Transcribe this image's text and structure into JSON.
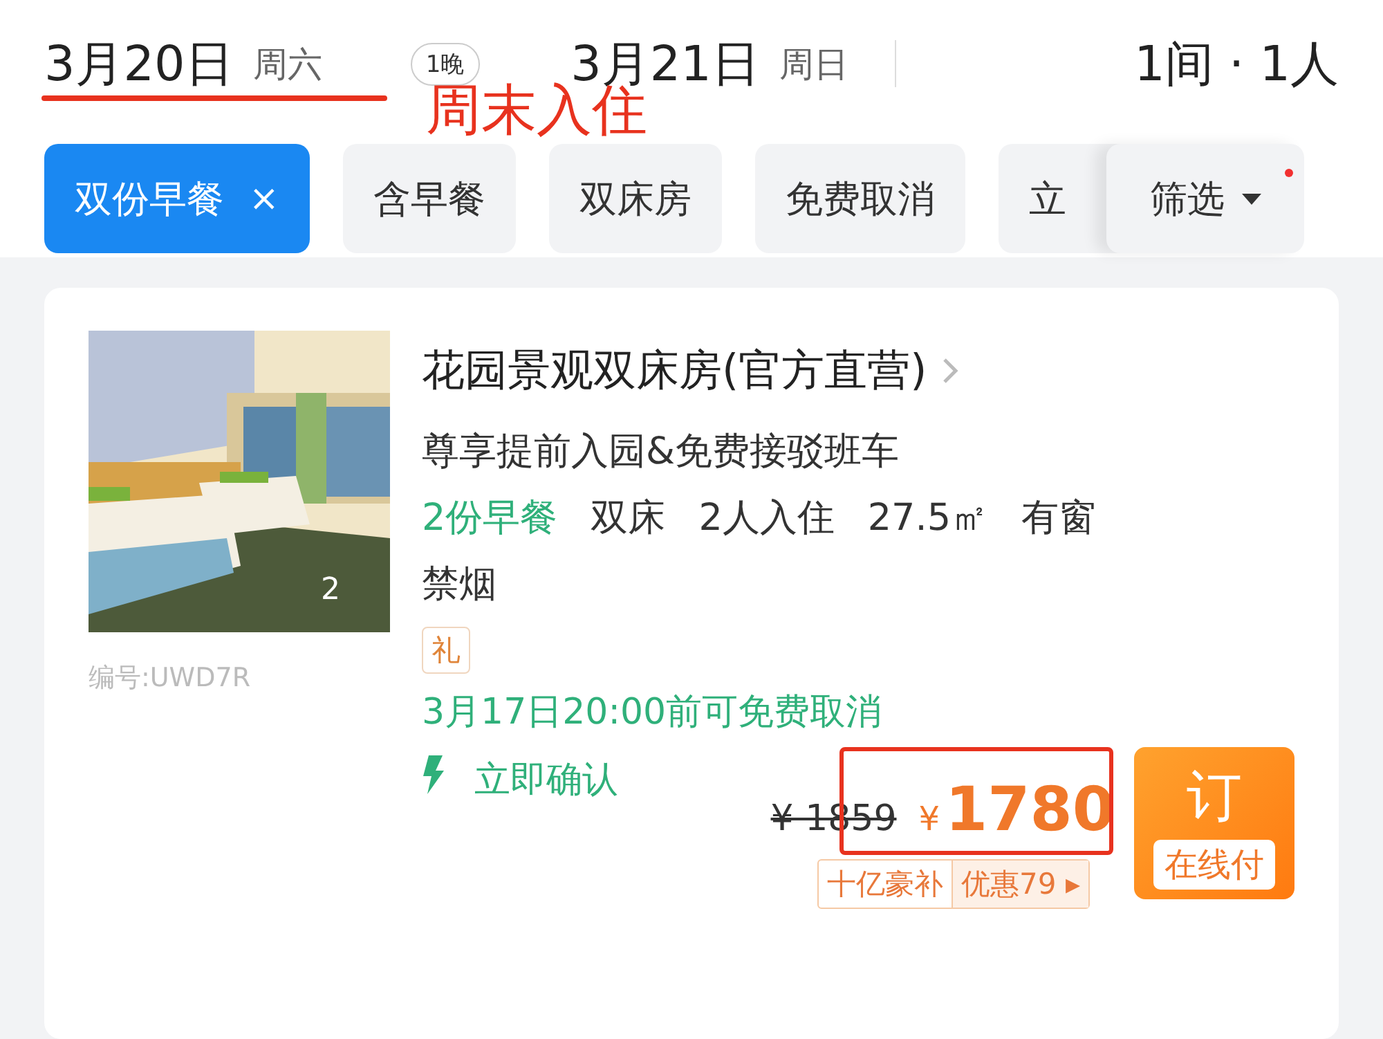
{
  "header": {
    "check_in": {
      "date": "3月20日",
      "weekday": "周六"
    },
    "nights": "1晚",
    "check_out": {
      "date": "3月21日",
      "weekday": "周日"
    },
    "rooms_guests": "1间 · 1人"
  },
  "annotation": {
    "text": "周末入住"
  },
  "filters": [
    {
      "label": "双份早餐",
      "selected": true,
      "close_icon": "×"
    },
    {
      "label": "含早餐",
      "selected": false
    },
    {
      "label": "双床房",
      "selected": false
    },
    {
      "label": "免费取消",
      "selected": false
    },
    {
      "label": "立",
      "selected": false
    }
  ],
  "filter_button": {
    "label": "筛选",
    "badge": true
  },
  "room": {
    "photo": {
      "kind": "picture",
      "count": "2"
    },
    "code": "编号:UWD7R",
    "title": "花园景观双床房(官方直营)",
    "perk": "尊享提前入园&免费接驳班车",
    "features": [
      {
        "text": "2份早餐",
        "highlight": true
      },
      {
        "text": "双床",
        "highlight": false
      },
      {
        "text": "2人入住",
        "highlight": false
      },
      {
        "text": "27.5㎡",
        "highlight": false
      },
      {
        "text": "有窗",
        "highlight": false
      },
      {
        "text": "禁烟",
        "highlight": false
      }
    ],
    "gift_tag": "礼",
    "cancellation": "3月17日20:00前可免费取消",
    "confirmation": "立即确认",
    "original_price": "¥ 1859",
    "currency": "¥",
    "price": "1780",
    "promo_tags": [
      "十亿豪补",
      "优惠79"
    ],
    "promo_arrow": "▸",
    "book_button": {
      "label": "订",
      "sublabel": "在线付"
    }
  }
}
